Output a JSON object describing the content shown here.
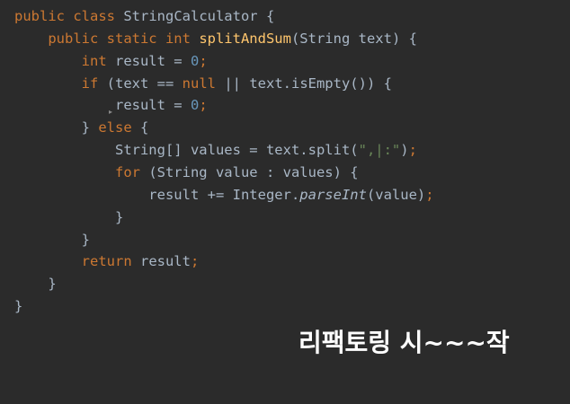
{
  "editor": {
    "language": "java",
    "lines": [
      [
        {
          "t": "public class ",
          "c": "keyword"
        },
        {
          "t": "StringCalculator {",
          "c": "plain"
        }
      ],
      [
        {
          "t": "    public static int ",
          "c": "keyword"
        },
        {
          "t": "splitAndSum",
          "c": "method"
        },
        {
          "t": "(String text) {",
          "c": "plain"
        }
      ],
      [
        {
          "t": "        int ",
          "c": "keyword"
        },
        {
          "t": "result = ",
          "c": "plain"
        },
        {
          "t": "0",
          "c": "number"
        },
        {
          "t": ";",
          "c": "keyword"
        }
      ],
      [
        {
          "t": "        if ",
          "c": "keyword"
        },
        {
          "t": "(text == ",
          "c": "plain"
        },
        {
          "t": "null ",
          "c": "keyword"
        },
        {
          "t": "|| text.isEmpty()) {",
          "c": "plain"
        }
      ],
      [
        {
          "t": "            result = ",
          "c": "plain"
        },
        {
          "t": "0",
          "c": "number"
        },
        {
          "t": ";",
          "c": "keyword"
        }
      ],
      [
        {
          "t": "        } ",
          "c": "plain"
        },
        {
          "t": "else ",
          "c": "keyword"
        },
        {
          "t": "{",
          "c": "plain"
        }
      ],
      [
        {
          "t": "            String[] values = text.split(",
          "c": "plain"
        },
        {
          "t": "\",|:\"",
          "c": "string"
        },
        {
          "t": ")",
          "c": "plain"
        },
        {
          "t": ";",
          "c": "keyword"
        }
      ],
      [
        {
          "t": "            for ",
          "c": "keyword"
        },
        {
          "t": "(String value : values) {",
          "c": "plain"
        }
      ],
      [
        {
          "t": "                result += Integer.",
          "c": "plain"
        },
        {
          "t": "parseInt",
          "c": "italic"
        },
        {
          "t": "(value)",
          "c": "plain"
        },
        {
          "t": ";",
          "c": "keyword"
        }
      ],
      [
        {
          "t": "            }",
          "c": "plain"
        }
      ],
      [
        {
          "t": "        }",
          "c": "plain"
        }
      ],
      [
        {
          "t": "        return ",
          "c": "keyword"
        },
        {
          "t": "result",
          "c": "plain"
        },
        {
          "t": ";",
          "c": "keyword"
        }
      ],
      [
        {
          "t": "    }",
          "c": "plain"
        }
      ],
      [
        {
          "t": "}",
          "c": "plain"
        }
      ]
    ]
  },
  "subtitle": {
    "text": "리팩토링 시~~~작"
  },
  "colors": {
    "background": "#2b2b2b",
    "plain": "#a9b7c6",
    "keyword": "#cc7832",
    "number": "#6897bb",
    "string": "#6a8759",
    "method": "#ffc66d",
    "subtitle": "#ffffff"
  }
}
